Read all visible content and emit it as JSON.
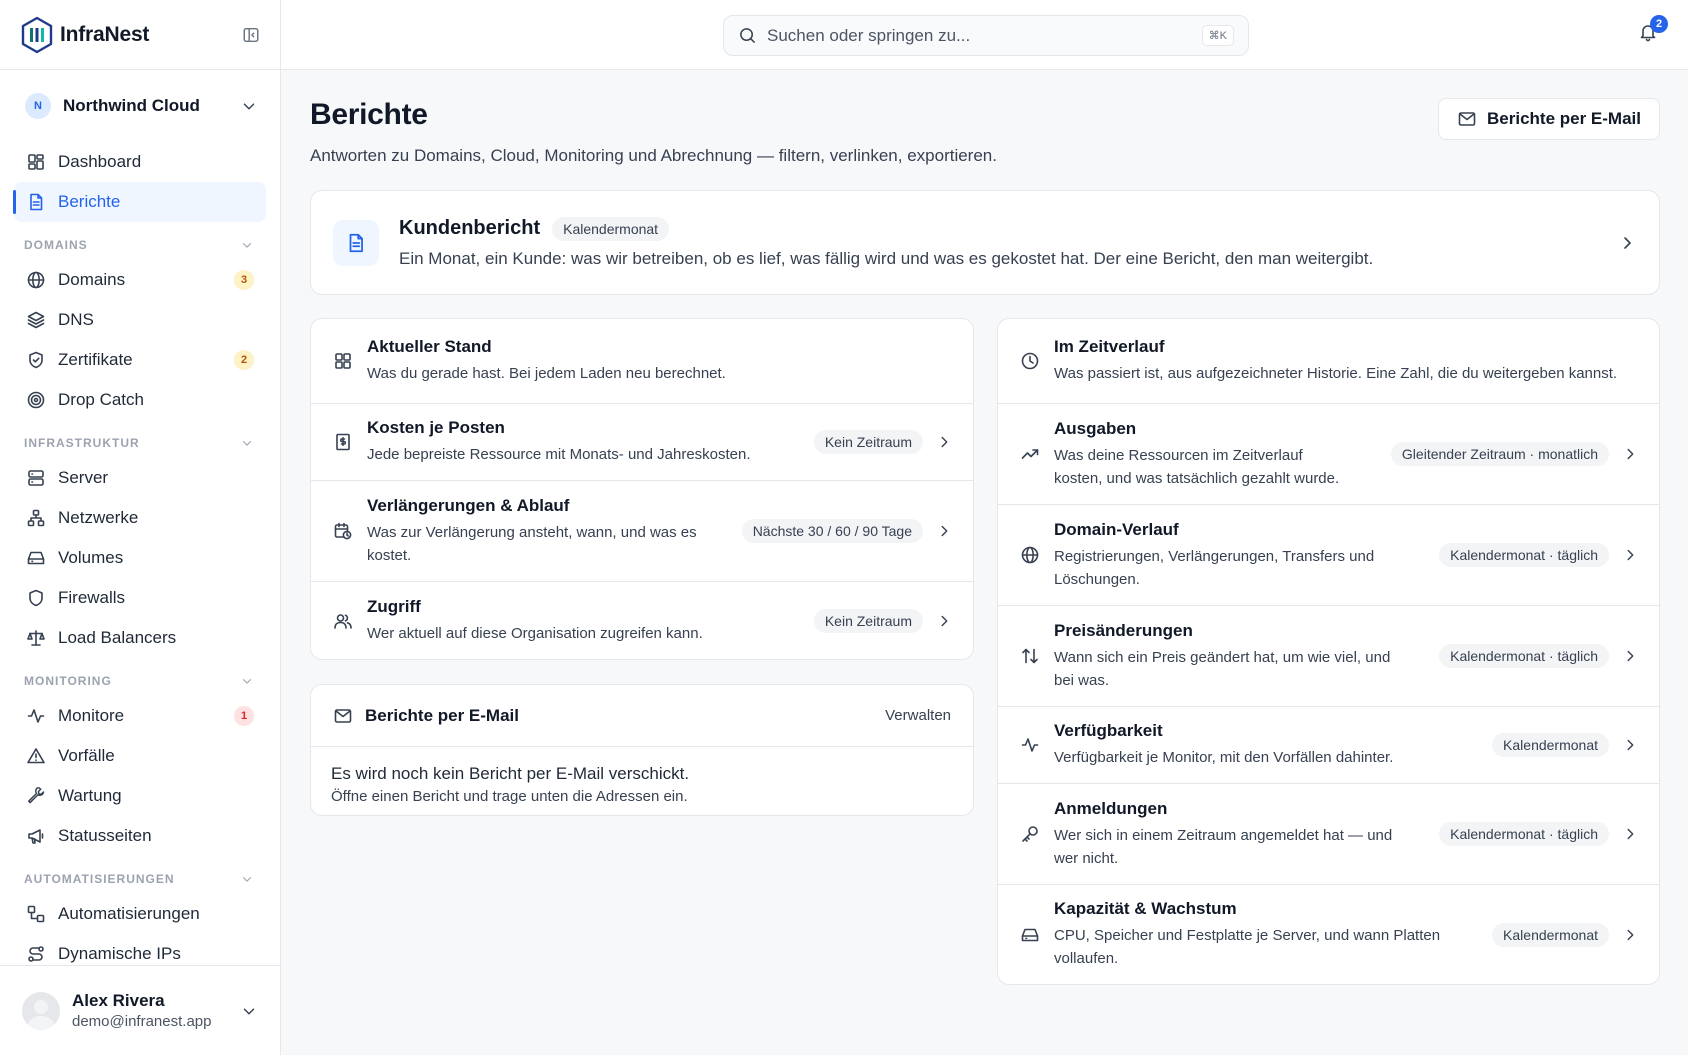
{
  "brand": {
    "name": "InfraNest"
  },
  "org": {
    "initial": "N",
    "name": "Northwind Cloud"
  },
  "nav": {
    "dashboard": "Dashboard",
    "berichte": "Berichte",
    "sections": {
      "domains": "DOMAINS",
      "infrastruktur": "INFRASTRUKTUR",
      "monitoring": "MONITORING",
      "automatisierungen": "AUTOMATISIERUNGEN"
    },
    "domains": {
      "label": "Domains",
      "badge": "3"
    },
    "dns": "DNS",
    "zertifikate": {
      "label": "Zertifikate",
      "badge": "2"
    },
    "dropcatch": "Drop Catch",
    "server": "Server",
    "netzwerke": "Netzwerke",
    "volumes": "Volumes",
    "firewalls": "Firewalls",
    "loadbalancers": "Load Balancers",
    "monitore": {
      "label": "Monitore",
      "badge": "1"
    },
    "vorfaelle": "Vorfälle",
    "wartung": "Wartung",
    "statusseiten": "Statusseiten",
    "automatisierungen": "Automatisierungen",
    "dynamischeips": "Dynamische IPs"
  },
  "user": {
    "name": "Alex Rivera",
    "email": "demo@infranest.app"
  },
  "topbar": {
    "search_placeholder": "Suchen oder springen zu...",
    "shortcut": "⌘K",
    "notifications": "2"
  },
  "page": {
    "title": "Berichte",
    "subtitle": "Antworten zu Domains, Cloud, Monitoring und Abrechnung — filtern, verlinken, exportieren.",
    "email_button": "Berichte per E-Mail"
  },
  "featured": {
    "title": "Kundenbericht",
    "pill": "Kalendermonat",
    "desc": "Ein Monat, ein Kunde: was wir betreiben, ob es lief, was fällig wird und was es gekostet hat. Der eine Bericht, den man weitergibt."
  },
  "current": {
    "title": "Aktueller Stand",
    "desc": "Was du gerade hast. Bei jedem Laden neu berechnet.",
    "items": [
      {
        "title": "Kosten je Posten",
        "desc": "Jede bepreiste Ressource mit Monats- und Jahreskosten.",
        "pill": "Kein Zeitraum"
      },
      {
        "title": "Verlängerungen & Ablauf",
        "desc": "Was zur Verlängerung ansteht, wann, und was es kostet.",
        "pill": "Nächste 30 / 60 / 90 Tage"
      },
      {
        "title": "Zugriff",
        "desc": "Wer aktuell auf diese Organisation zugreifen kann.",
        "pill": "Kein Zeitraum"
      }
    ]
  },
  "history": {
    "title": "Im Zeitverlauf",
    "desc": "Was passiert ist, aus aufgezeichneter Historie. Eine Zahl, die du weitergeben kannst.",
    "items": [
      {
        "title": "Ausgaben",
        "desc": "Was deine Ressourcen im Zeitverlauf kosten, und was tatsächlich gezahlt wurde.",
        "pill": "Gleitender Zeitraum · monatlich"
      },
      {
        "title": "Domain-Verlauf",
        "desc": "Registrierungen, Verlängerungen, Transfers und Löschungen.",
        "pill": "Kalendermonat · täglich"
      },
      {
        "title": "Preisänderungen",
        "desc": "Wann sich ein Preis geändert hat, um wie viel, und bei was.",
        "pill": "Kalendermonat · täglich"
      },
      {
        "title": "Verfügbarkeit",
        "desc": "Verfügbarkeit je Monitor, mit den Vorfällen dahinter.",
        "pill": "Kalendermonat"
      },
      {
        "title": "Anmeldungen",
        "desc": "Wer sich in einem Zeitraum angemeldet hat — und wer nicht.",
        "pill": "Kalendermonat · täglich"
      },
      {
        "title": "Kapazität & Wachstum",
        "desc": "CPU, Speicher und Festplatte je Server, und wann Platten vollaufen.",
        "pill": "Kalendermonat"
      }
    ]
  },
  "emailreports": {
    "title": "Berichte per E-Mail",
    "manage": "Verwalten",
    "empty_title": "Es wird noch kein Bericht per E-Mail verschickt.",
    "empty_desc": "Öffne einen Bericht und trage unten die Adressen ein."
  }
}
